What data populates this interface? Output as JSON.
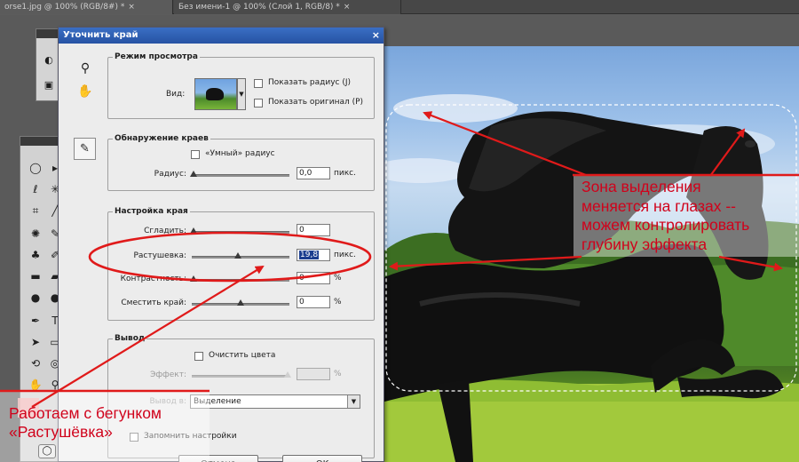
{
  "tabs": [
    {
      "label": "orse1.jpg @ 100% (RGB/8#) *",
      "close": "×"
    },
    {
      "label": "Без имени-1 @ 100% (Слой 1, RGB/8) *",
      "close": "×"
    }
  ],
  "dialog": {
    "title": "Уточнить край",
    "close": "×",
    "view_mode": {
      "legend": "Режим просмотра",
      "view_label": "Вид:",
      "show_radius": "Показать радиус (J)",
      "show_original": "Показать оригинал (P)"
    },
    "edge_detection": {
      "legend": "Обнаружение краев",
      "smart_radius": "«Умный» радиус",
      "radius_label": "Радиус:",
      "radius_value": "0,0",
      "unit": "пикс."
    },
    "adjust_edge": {
      "legend": "Настройка края",
      "smooth_label": "Сгладить:",
      "smooth_value": "0",
      "feather_label": "Растушевка:",
      "feather_value": "19,8",
      "feather_unit": "пикс.",
      "contrast_label": "Контрастность:",
      "contrast_value": "0",
      "contrast_unit": "%",
      "shift_label": "Сместить край:",
      "shift_value": "0",
      "shift_unit": "%"
    },
    "output": {
      "legend": "Вывод",
      "decontaminate": "Очистить цвета",
      "amount_label": "Эффект:",
      "amount_unit": "%",
      "output_to_label": "Вывод в:",
      "output_to_value": "Выделение",
      "remember": "Запомнить настройки"
    },
    "buttons": {
      "cancel": "Отмена",
      "ok": "OK"
    }
  },
  "annotations": {
    "right_note": [
      "Зона выделения",
      "меняется на глазах --",
      "можем контролировать",
      "глубину эффекта"
    ],
    "left_note": [
      "Работаем с бегунком",
      "«Растушёвка»"
    ],
    "color": "#d0021b"
  },
  "icons": {
    "zoom": "magnifier-icon",
    "hand": "hand-icon",
    "brush": "refine-radius-brush-icon"
  }
}
